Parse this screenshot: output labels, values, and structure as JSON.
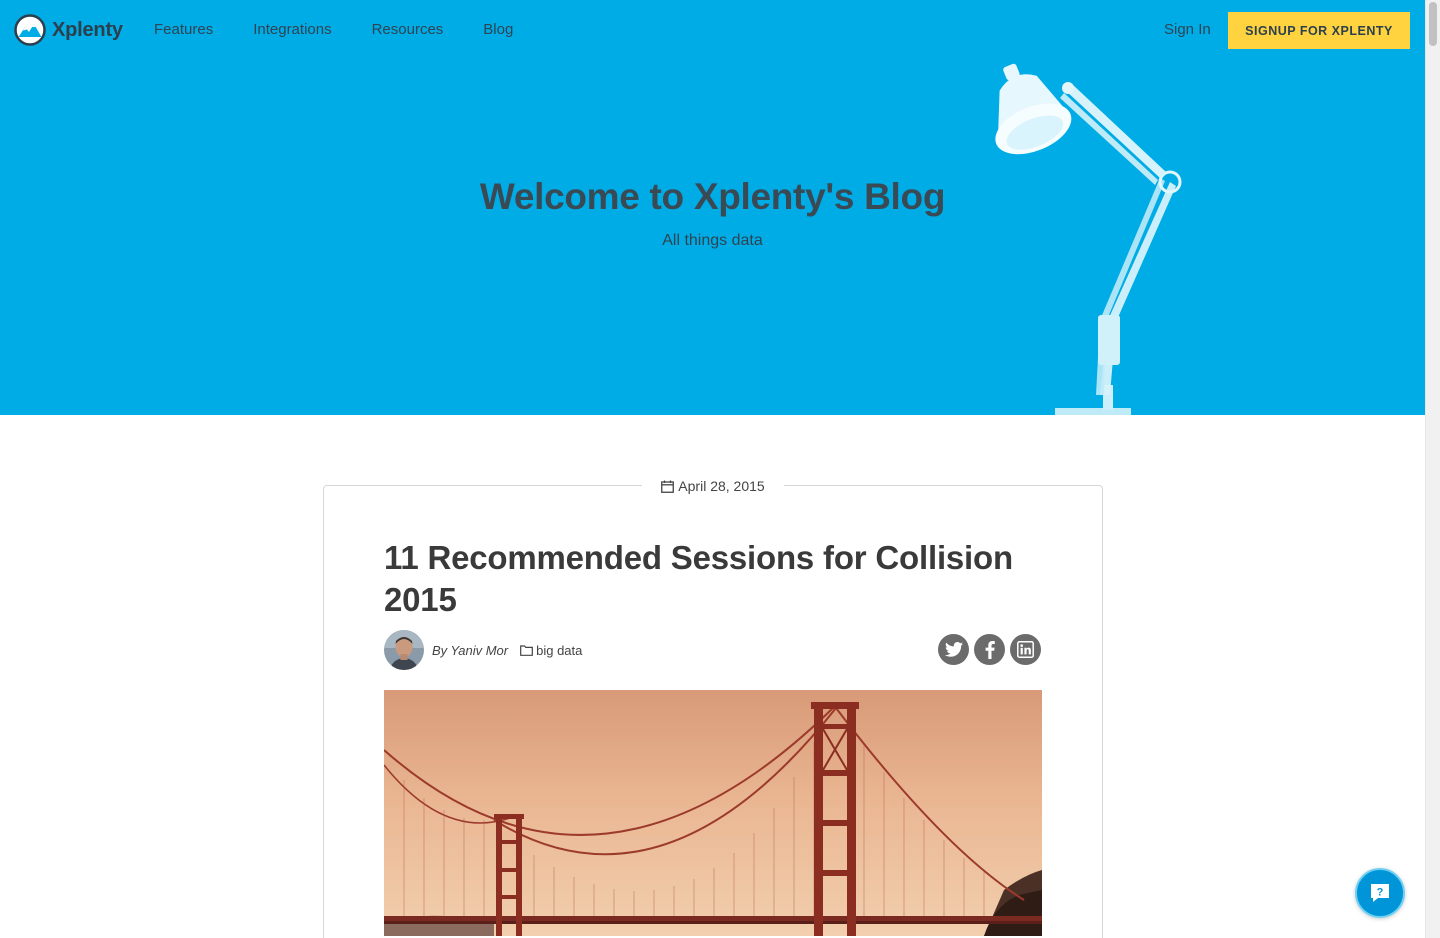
{
  "header": {
    "brand": "Xplenty",
    "nav": [
      {
        "label": "Features"
      },
      {
        "label": "Integrations"
      },
      {
        "label": "Resources"
      },
      {
        "label": "Blog"
      }
    ],
    "sign_in": "Sign In",
    "signup_button": "SIGNUP FOR XPLENTY"
  },
  "hero": {
    "title": "Welcome to Xplenty's Blog",
    "subtitle": "All things data"
  },
  "post": {
    "date": "April 28, 2015",
    "title": "11 Recommended Sessions for Collision 2015",
    "author": "By Yaniv Mor",
    "category": "big data",
    "share": [
      {
        "network": "twitter",
        "icon": "twitter-icon"
      },
      {
        "network": "facebook",
        "icon": "facebook-icon"
      },
      {
        "network": "linkedin",
        "icon": "linkedin-icon"
      }
    ],
    "image_subject": "golden-gate-bridge"
  },
  "help_button": {
    "label": "?"
  },
  "colors": {
    "hero_bg": "#00ace6",
    "cta_bg": "#ffd23f",
    "text_dark": "#3a3a3a",
    "social_grey": "#6b6b6b",
    "help_blue": "#0095d9"
  }
}
